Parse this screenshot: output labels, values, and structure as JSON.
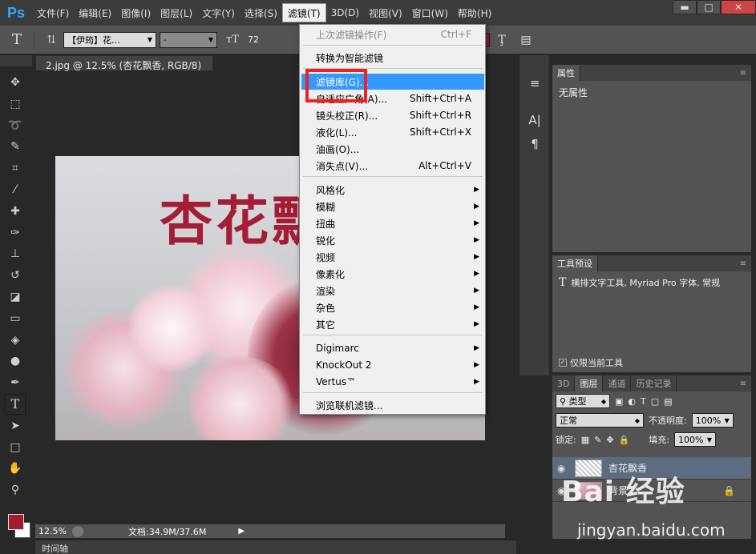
{
  "app": {
    "logo": "Ps"
  },
  "menubar": {
    "items": [
      "文件(F)",
      "编辑(E)",
      "图像(I)",
      "图层(L)",
      "文字(Y)",
      "选择(S)",
      "滤镜(T)",
      "3D(D)",
      "视图(V)",
      "窗口(W)",
      "帮助(H)"
    ],
    "active_index": 6
  },
  "window_controls": {
    "minimize": "▬",
    "maximize": "□",
    "close": "✕"
  },
  "options_bar": {
    "tool_glyph": "T",
    "orient_glyph": "⇅",
    "font_family": "【伊筠】花…",
    "font_style": "-",
    "size_glyph": "тT",
    "font_size": "72",
    "color_swatch": "#a31d32"
  },
  "document": {
    "tab_title": "2.jpg @ 12.5% (杏花飘香, RGB/8) *",
    "canvas_title": "杏花飘",
    "status_zoom": "12.5%",
    "status_doc": "文档:34.9M/37.6M",
    "timeline_label": "时间轴"
  },
  "filter_menu": {
    "last_filter": {
      "label": "上次滤镜操作(F)",
      "shortcut": "Ctrl+F"
    },
    "smart": "转换为智能滤镜",
    "gallery": "滤镜库(G)...",
    "adaptive_wide": {
      "label": "自适应广角(A)...",
      "shortcut": "Shift+Ctrl+A"
    },
    "lens": {
      "label": "镜头校正(R)...",
      "shortcut": "Shift+Ctrl+R"
    },
    "liquify": {
      "label": "液化(L)...",
      "shortcut": "Shift+Ctrl+X"
    },
    "oil": "油画(O)...",
    "vanish": {
      "label": "消失点(V)...",
      "shortcut": "Alt+Ctrl+V"
    },
    "submenus_1": [
      "风格化",
      "模糊",
      "扭曲",
      "锐化",
      "视频",
      "像素化",
      "渲染",
      "杂色",
      "其它"
    ],
    "submenus_2": [
      "Digimarc",
      "KnockOut 2",
      "Vertus™"
    ],
    "browse": "浏览联机滤镜..."
  },
  "properties_panel": {
    "tab": "属性",
    "body": "无属性"
  },
  "tool_presets": {
    "tab": "工具预设",
    "line": "横排文字工具, Myriad Pro 字体, 常规",
    "current_only": "仅限当前工具"
  },
  "layers_panel": {
    "tabs": [
      "3D",
      "图层",
      "通道",
      "历史记录"
    ],
    "filter_kind": "类型",
    "blend_mode": "正常",
    "opacity_label": "不透明度:",
    "opacity_value": "100%",
    "lock_label": "锁定:",
    "fill_label": "填充:",
    "fill_value": "100%",
    "layers": [
      {
        "name": "杏花飘香",
        "active": true
      },
      {
        "name": "背景",
        "active": false
      }
    ]
  },
  "watermark": {
    "brand": "Bai 经验",
    "url": "jingyan.baidu.com"
  }
}
